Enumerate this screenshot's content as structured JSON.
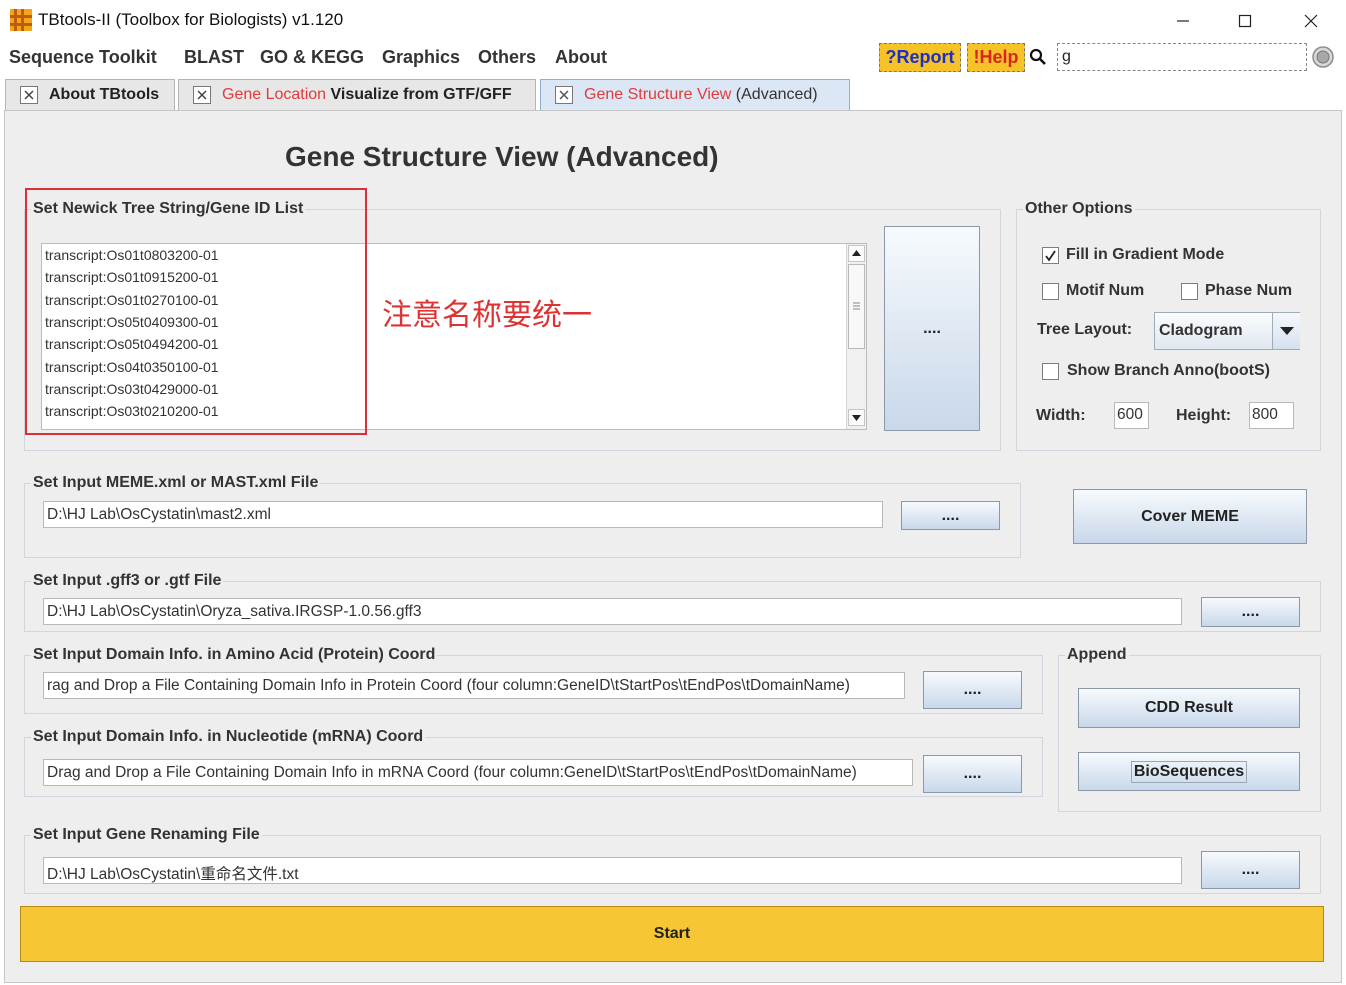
{
  "window": {
    "title": "TBtools-II (Toolbox for Biologists) v1.120"
  },
  "menu": {
    "items": [
      "Sequence Toolkit",
      "BLAST",
      "GO & KEGG",
      "Graphics",
      "Others",
      "About"
    ],
    "report_label": "?Report",
    "help_label": "!Help",
    "search_value": "g"
  },
  "tabs": [
    {
      "label": "About TBtools"
    },
    {
      "label_red": "Gene Location",
      "label_rest": " Visualize from GTF/GFF"
    },
    {
      "label_red": "Gene Structure View",
      "label_rest": " (Advanced)"
    }
  ],
  "page_title": "Gene Structure View (Advanced)",
  "newick": {
    "label": "Set Newick Tree String/Gene ID List",
    "ids": [
      "transcript:Os01t0803200-01",
      "transcript:Os01t0915200-01",
      "transcript:Os01t0270100-01",
      "transcript:Os05t0409300-01",
      "transcript:Os05t0494200-01",
      "transcript:Os04t0350100-01",
      "transcript:Os03t0429000-01",
      "transcript:Os03t0210200-01"
    ],
    "browse_label": "....",
    "annotation": "注意名称要统一"
  },
  "other_options": {
    "label": "Other Options",
    "fill_gradient_label": "Fill in Gradient Mode",
    "fill_gradient_checked": true,
    "motif_num_label": "Motif Num",
    "phase_num_label": "Phase Num",
    "tree_layout_label": "Tree Layout:",
    "tree_layout_value": "Cladogram",
    "show_branch_label": "Show Branch Anno(bootS)",
    "width_label": "Width:",
    "width_value": "600",
    "height_label": "Height:",
    "height_value": "800"
  },
  "meme": {
    "label": "Set Input MEME.xml or MAST.xml File",
    "value": "D:\\HJ Lab\\OsCystatin\\mast2.xml",
    "browse_label": "....",
    "cover_label": "Cover MEME"
  },
  "gff": {
    "label": "Set Input .gff3 or .gtf File",
    "value": "D:\\HJ Lab\\OsCystatin\\Oryza_sativa.IRGSP-1.0.56.gff3",
    "browse_label": "...."
  },
  "domain_protein": {
    "label": "Set Input Domain Info. in Amino Acid (Protein) Coord",
    "value": "rag and Drop a File Containing Domain Info in Protein Coord (four column:GeneID\\tStartPos\\tEndPos\\tDomainName)",
    "browse_label": "...."
  },
  "domain_mrna": {
    "label": "Set Input Domain Info. in Nucleotide (mRNA) Coord",
    "value": "Drag and Drop a File Containing Domain Info in mRNA Coord (four column:GeneID\\tStartPos\\tEndPos\\tDomainName)",
    "browse_label": "...."
  },
  "append": {
    "label": "Append",
    "cdd_label": "CDD Result",
    "bioseq_label": "BioSequences"
  },
  "renaming": {
    "label": "Set Input Gene Renaming File",
    "value": "D:\\HJ Lab\\OsCystatin\\重命名文件.txt",
    "browse_label": "...."
  },
  "start_label": "Start",
  "colors": {
    "accent_yellow": "#f7c634",
    "tab_red": "#e03c3c",
    "annotation_red": "#d9303a"
  }
}
